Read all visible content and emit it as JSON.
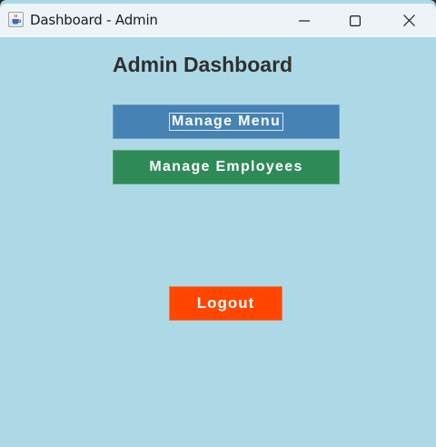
{
  "window": {
    "title": "Dashboard - Admin",
    "app_icon": "java-cup-icon",
    "controls": [
      "minimize-icon",
      "maximize-icon",
      "close-icon"
    ]
  },
  "main": {
    "heading": "Admin Dashboard",
    "buttons": {
      "manage_menu": "Manage Menu",
      "manage_employees": "Manage Employees",
      "logout": "Logout"
    }
  },
  "colors": {
    "background": "#add8e6",
    "manage_menu": "#4682b4",
    "manage_employees": "#2e8b57",
    "logout": "#ff4500"
  }
}
